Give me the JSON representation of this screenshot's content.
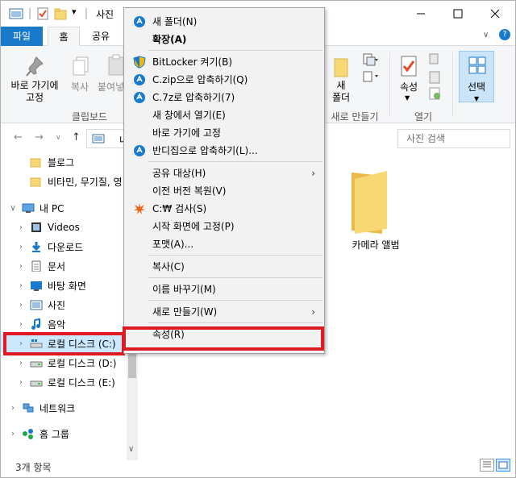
{
  "window": {
    "title": "사진"
  },
  "tabs": {
    "file": "파일",
    "home": "홈",
    "share": "공유"
  },
  "ribbon": {
    "pin": "바로 가기에\n고정",
    "copy": "복사",
    "paste": "붙여넣",
    "new_folder": "새\n폴더",
    "properties": "속성",
    "select": "선택",
    "groups": {
      "clipboard": "클립보드",
      "new": "새로 만들기",
      "open": "열기"
    }
  },
  "nav": {
    "address_fragment": "내",
    "search_placeholder": "사진 검색"
  },
  "tree": [
    {
      "label": "블로그",
      "icon": "folder",
      "chev": false
    },
    {
      "label": "비타민, 무기질, 영",
      "icon": "folder",
      "chev": false
    },
    {
      "label": "내 PC",
      "icon": "pc",
      "chev": "down"
    },
    {
      "label": "Videos",
      "icon": "videos",
      "chev": "right"
    },
    {
      "label": "다운로드",
      "icon": "download",
      "chev": "right"
    },
    {
      "label": "문서",
      "icon": "document",
      "chev": "right"
    },
    {
      "label": "바탕 화면",
      "icon": "desktop",
      "chev": "right"
    },
    {
      "label": "사진",
      "icon": "pictures",
      "chev": "right"
    },
    {
      "label": "음악",
      "icon": "music",
      "chev": "right"
    },
    {
      "label": "로컬 디스크 (C:)",
      "icon": "drive-c",
      "chev": "right",
      "selected": true
    },
    {
      "label": "로컬 디스크 (D:)",
      "icon": "drive",
      "chev": "right"
    },
    {
      "label": "로컬 디스크 (E:)",
      "icon": "drive",
      "chev": "right"
    },
    {
      "label": "네트워크",
      "icon": "network",
      "chev": "right"
    },
    {
      "label": "홈 그룹",
      "icon": "homegroup",
      "chev": "right"
    }
  ],
  "content": {
    "folder_name": "카메라 앨범"
  },
  "status": {
    "item_count": "3개 항목"
  },
  "context_menu": [
    {
      "label": "새 폴더(N)",
      "icon": "cloud-icon"
    },
    {
      "label": "확장(A)",
      "bold": true
    },
    {
      "sep": true
    },
    {
      "label": "BitLocker 켜기(B)",
      "icon": "shield-icon"
    },
    {
      "label": "C.zip으로 압축하기(Q)",
      "icon": "cloud-icon"
    },
    {
      "label": "C.7z로 압축하기(7)",
      "icon": "cloud-icon"
    },
    {
      "label": "새 창에서 열기(E)"
    },
    {
      "label": "바로 가기에 고정"
    },
    {
      "label": "반디집으로 압축하기(L)...",
      "icon": "cloud-icon"
    },
    {
      "sep": true
    },
    {
      "label": "공유 대상(H)",
      "submenu": true
    },
    {
      "label": "이전 버전 복원(V)"
    },
    {
      "label": "C:₩ 검사(S)",
      "icon": "scan-icon"
    },
    {
      "label": "시작 화면에 고정(P)"
    },
    {
      "label": "포맷(A)..."
    },
    {
      "sep": true
    },
    {
      "label": "복사(C)"
    },
    {
      "sep": true
    },
    {
      "label": "이름 바꾸기(M)"
    },
    {
      "sep": true
    },
    {
      "label": "새로 만들기(W)",
      "submenu": true
    },
    {
      "sep": true
    },
    {
      "label": "속성(R)"
    }
  ],
  "colors": {
    "accent": "#1979ca",
    "highlight": "#e01a22",
    "selection": "#cce8ff",
    "folder": "#f8d775"
  }
}
